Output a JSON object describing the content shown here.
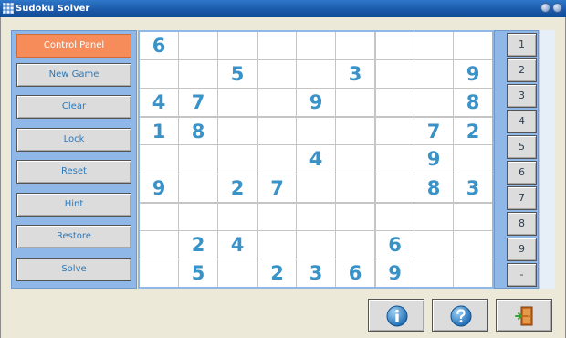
{
  "window": {
    "title": "Sudoku Solver"
  },
  "panel": {
    "header": "Control Panel",
    "buttons": [
      "New Game",
      "Clear",
      "Lock",
      "Reset",
      "Hint",
      "Restore",
      "Solve"
    ]
  },
  "board": {
    "grid": [
      [
        "6",
        "",
        "",
        "",
        "",
        "",
        "",
        "",
        ""
      ],
      [
        "",
        "",
        "5",
        "",
        "",
        "3",
        "",
        "",
        "9"
      ],
      [
        "4",
        "7",
        "",
        "",
        "9",
        "",
        "",
        "",
        "8"
      ],
      [
        "1",
        "8",
        "",
        "",
        "",
        "",
        "",
        "7",
        "2"
      ],
      [
        "",
        "",
        "",
        "",
        "4",
        "",
        "",
        "9",
        ""
      ],
      [
        "9",
        "",
        "2",
        "7",
        "",
        "",
        "",
        "8",
        "3"
      ],
      [
        "",
        "",
        "",
        "",
        "",
        "",
        "",
        "",
        ""
      ],
      [
        "",
        "2",
        "4",
        "",
        "",
        "",
        "6",
        "",
        ""
      ],
      [
        "",
        "5",
        "",
        "2",
        "3",
        "6",
        "9",
        "",
        ""
      ]
    ]
  },
  "number_column": [
    "1",
    "2",
    "3",
    "4",
    "5",
    "6",
    "7",
    "8",
    "9",
    "-"
  ],
  "icons": {
    "app": "sudoku-app-icon",
    "info": "info-icon",
    "help": "help-icon",
    "exit": "exit-door-icon"
  },
  "colors": {
    "digit": "#3992c8",
    "panel_bg": "#8fb8e8",
    "header_bg": "#f58c5a",
    "titlebar": "#1a58a8"
  }
}
